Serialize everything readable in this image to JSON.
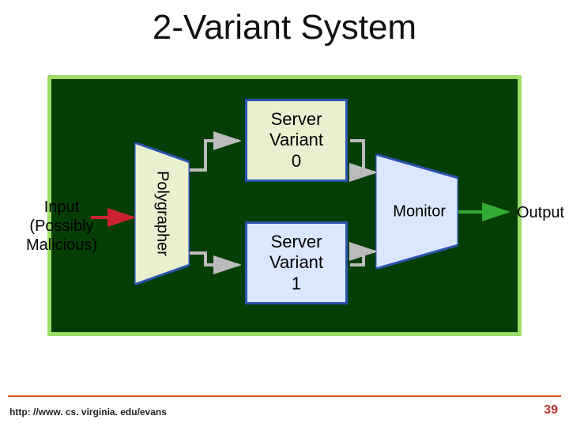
{
  "title": "2-Variant System",
  "input_label": "Input\n(Possibly\nMalicious)",
  "polygrapher_label": "Polygrapher",
  "server0_label": "Server\nVariant\n0",
  "server1_label": "Server\nVariant\n1",
  "monitor_label": "Monitor",
  "output_label": "Output",
  "footer_url": "http: //www. cs. virginia. edu/evans",
  "page_number": "39",
  "colors": {
    "diagram_bg": "#053f05",
    "diagram_border": "#9cdc67",
    "poly_fill": "#e8f0d0",
    "mon_fill": "#dbe6ff",
    "arrow_input": "#cc2233",
    "arrow_neutral": "#bbbbbb",
    "arrow_output": "#33aa33"
  }
}
